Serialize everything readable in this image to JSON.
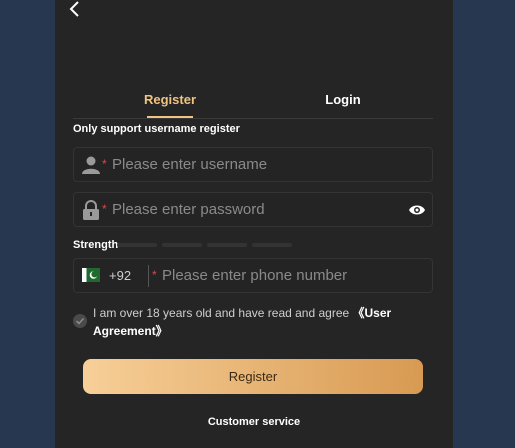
{
  "tabs": {
    "register": "Register",
    "login": "Login"
  },
  "hint": "Only support username register",
  "username": {
    "placeholder": "Please enter username",
    "required_mark": "*"
  },
  "password": {
    "placeholder": "Please enter password",
    "required_mark": "*"
  },
  "strength": {
    "label": "Strength"
  },
  "phone": {
    "country_code": "+92",
    "placeholder": "Please enter phone number",
    "required_mark": "*"
  },
  "agreement": {
    "text": "I am over 18 years old and have read and agree ",
    "link": "《User Agreement》"
  },
  "register_button": "Register",
  "customer_service": "Customer service",
  "colors": {
    "accent": "#f0c380",
    "panel_bg": "#252525",
    "page_bg": "#26374f"
  },
  "icons": {
    "back": "chevron-left-icon",
    "username": "user-icon",
    "password": "lock-icon",
    "visibility": "eye-icon",
    "country": "pakistan-flag-icon",
    "agree": "check-circle-icon"
  }
}
